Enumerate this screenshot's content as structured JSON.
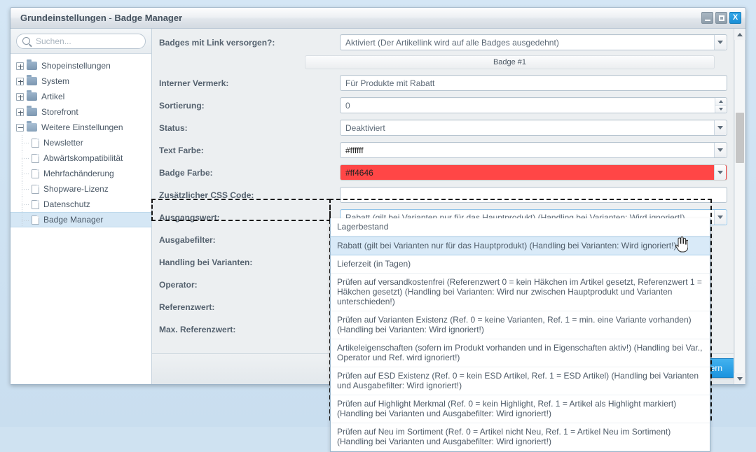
{
  "window": {
    "title_main": "Grundeinstellungen",
    "title_sep": " - ",
    "title_sub": "Badge Manager",
    "buttons": {
      "minimize": "minimize-icon",
      "maximize": "maximize-icon",
      "close": "X"
    }
  },
  "sidebar": {
    "search": {
      "placeholder": "Suchen...",
      "value": "",
      "icon": "search-icon"
    },
    "items": [
      {
        "label": "Shopeinstellungen",
        "type": "folder",
        "expanded": false,
        "level": 0
      },
      {
        "label": "System",
        "type": "folder",
        "expanded": false,
        "level": 0
      },
      {
        "label": "Artikel",
        "type": "folder",
        "expanded": false,
        "level": 0
      },
      {
        "label": "Storefront",
        "type": "folder",
        "expanded": false,
        "level": 0
      },
      {
        "label": "Weitere Einstellungen",
        "type": "folder",
        "expanded": true,
        "level": 0
      },
      {
        "label": "Newsletter",
        "type": "doc",
        "level": 1
      },
      {
        "label": "Abwärtskompatibilität",
        "type": "doc",
        "level": 1
      },
      {
        "label": "Mehrfachänderung",
        "type": "doc",
        "level": 1
      },
      {
        "label": "Shopware-Lizenz",
        "type": "doc",
        "level": 1
      },
      {
        "label": "Datenschutz",
        "type": "doc",
        "level": 1
      },
      {
        "label": "Badge Manager",
        "type": "doc",
        "level": 1,
        "selected": true
      }
    ]
  },
  "form": {
    "badge_link_label": "Badges mit Link versorgen?:",
    "badge_link_value": "Aktiviert (Der Artikellink wird auf alle Badges ausgedehnt)",
    "section_title": "Badge #1",
    "fields": [
      {
        "label": "Interner Vermerk:",
        "value": "Für Produkte mit Rabatt",
        "type": "text"
      },
      {
        "label": "Sortierung:",
        "value": "0",
        "type": "spinner"
      },
      {
        "label": "Status:",
        "value": "Deaktiviert",
        "type": "select"
      },
      {
        "label": "Text Farbe:",
        "value": "#ffffff",
        "type": "colorselect",
        "swatch": "#ffffff"
      },
      {
        "label": "Badge Farbe:",
        "value": "#ff4646",
        "type": "colorselect",
        "swatch": "#ff4646"
      },
      {
        "label": "Zusätzlicher CSS Code:",
        "value": "",
        "type": "text"
      },
      {
        "label": "Ausgangswert:",
        "value": "Rabatt (gilt bei Varianten nur für das Hauptprodukt) (Handling bei Varianten: Wird ignoriert!)",
        "type": "select",
        "focused": true
      },
      {
        "label": "Ausgabefilter:",
        "value": "",
        "type": "select"
      },
      {
        "label": "Handling bei Varianten:",
        "value": "",
        "type": "select"
      },
      {
        "label": "Operator:",
        "value": "",
        "type": "select"
      },
      {
        "label": "Referenzwert:",
        "value": "",
        "type": "select"
      },
      {
        "label": "Max. Referenzwert:",
        "value": "",
        "type": "select"
      }
    ],
    "help_icon": "?",
    "save_label": "Speichern"
  },
  "dropdown": {
    "open": true,
    "selected_index": 1,
    "options": [
      "Lagerbestand",
      "Rabatt (gilt bei Varianten nur für das Hauptprodukt) (Handling bei Varianten: Wird ignoriert!)",
      "Lieferzeit (in Tagen)",
      "Prüfen auf versandkostenfrei (Referenzwert 0 = kein Häkchen im Artikel gesetzt, Referenzwert 1 = Häkchen gesetzt) (Handling bei Varianten: Wird nur zwischen Hauptprodukt und Varianten unterschieden!)",
      "Prüfen auf Varianten Existenz (Ref. 0 = keine Varianten, Ref. 1 = min. eine Variante vorhanden) (Handling bei Varianten: Wird ignoriert!)",
      "Artikeleigenschaften (sofern im Produkt vorhanden und in Eigenschaften aktiv!) (Handling bei Var., Operator und Ref. wird ignoriert!)",
      "Prüfen auf ESD Existenz (Ref. 0 = kein ESD Artikel, Ref. 1 = ESD Artikel) (Handling bei Varianten und Ausgabefilter: Wird ignoriert!)",
      "Prüfen auf Highlight Merkmal (Ref. 0 = kein Highlight, Ref. 1 = Artikel als Highlight markiert) (Handling bei Varianten und Ausgabefilter: Wird ignoriert!)",
      "Prüfen auf Neu im Sortiment (Ref. 0 = Artikel nicht Neu, Ref. 1 = Artikel Neu im Sortiment) (Handling bei Varianten und Ausgabefilter: Wird ignoriert!)"
    ]
  },
  "scrollbar": {
    "up": "chevron-up-icon",
    "down": "chevron-down-icon"
  },
  "colors": {
    "accent": "#1b93de",
    "badge_red": "#ff4646",
    "highlight": "#d9eaf8",
    "focus_dash": "#141414"
  }
}
